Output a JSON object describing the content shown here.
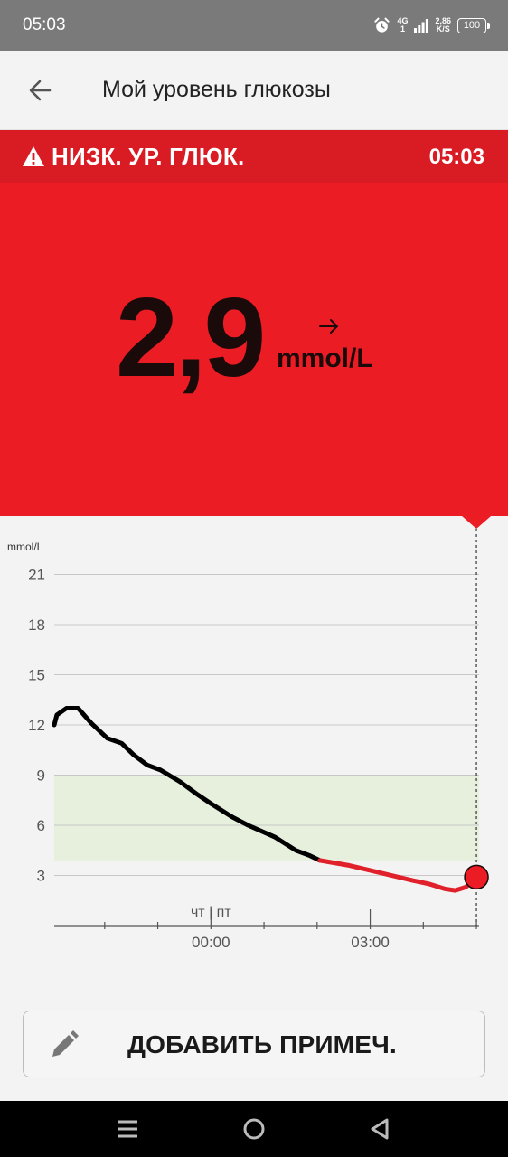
{
  "status_bar": {
    "time": "05:03",
    "network": "4G",
    "network_sub": "1",
    "speed_value": "2,86",
    "speed_unit": "K/S",
    "battery": "100"
  },
  "app_bar": {
    "title": "Мой уровень глюкозы"
  },
  "alert": {
    "text": "НИЗК. УР. ГЛЮК.",
    "time": "05:03"
  },
  "reading": {
    "value": "2,9",
    "unit": "mmol/L",
    "trend": "arrow-right"
  },
  "colors": {
    "alert_red": "#d91c24",
    "panel_red": "#ec1c24",
    "target_range": "#e6f0dc",
    "normal_line": "#000000",
    "low_line": "#e0202a"
  },
  "chart_data": {
    "type": "line",
    "ylabel": "mmol/L",
    "yticks": [
      3,
      6,
      9,
      12,
      15,
      18,
      21
    ],
    "ylim": [
      0,
      24
    ],
    "target_range": [
      3.9,
      9
    ],
    "xticks": [
      "00:00",
      "03:00"
    ],
    "day_divider": "чт | пт",
    "x_unit": "hours relative to 00:00 (Пт)",
    "xlim": [
      -2.95,
      5.05
    ],
    "low_threshold": 3.9,
    "series": [
      {
        "x": [
          -2.95,
          -2.9,
          -2.72,
          -2.5,
          -2.25,
          -1.95,
          -1.68,
          -1.45,
          -1.2,
          -0.95,
          -0.58,
          -0.28,
          0.0,
          0.4,
          0.7,
          1.2,
          1.6,
          1.85,
          2.05
        ],
        "y": [
          12.0,
          12.6,
          13.0,
          13.0,
          12.1,
          11.2,
          10.9,
          10.2,
          9.6,
          9.3,
          8.6,
          7.9,
          7.3,
          6.5,
          6.0,
          5.3,
          4.5,
          4.2,
          3.9
        ]
      },
      {
        "x": [
          2.05,
          2.6,
          3.0,
          3.4,
          3.8,
          4.1,
          4.4,
          4.6,
          4.8,
          5.0
        ],
        "y": [
          3.9,
          3.6,
          3.3,
          3.0,
          2.7,
          2.5,
          2.2,
          2.1,
          2.3,
          2.9
        ]
      }
    ],
    "current_point": {
      "x": 5.0,
      "y": 2.9
    }
  },
  "actions": {
    "add_note_label": "ДОБАВИТЬ ПРИМЕЧ."
  }
}
